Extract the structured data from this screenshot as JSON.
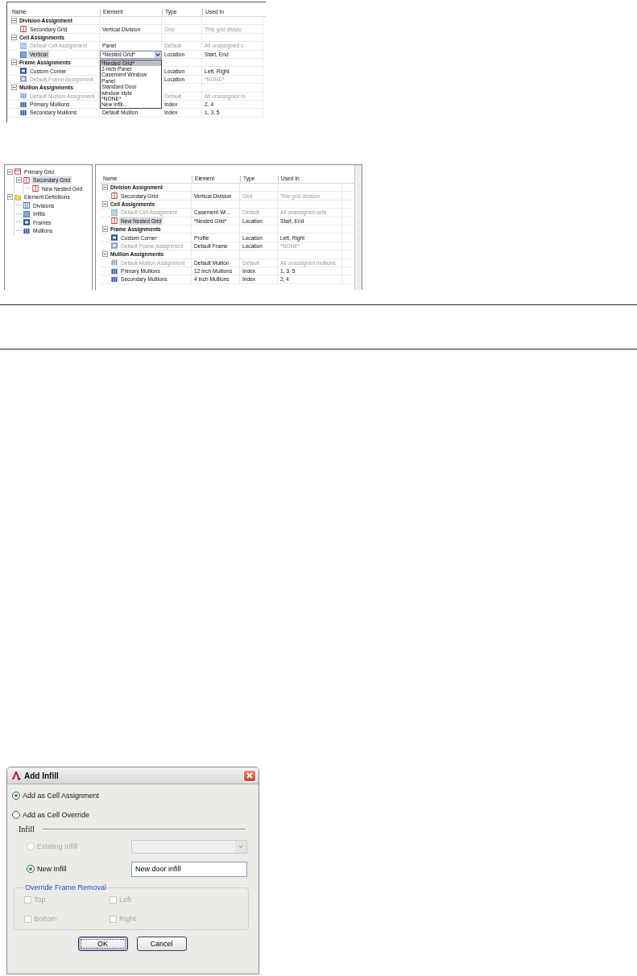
{
  "figure_1": {
    "columns": [
      "Name",
      "Element",
      "Type",
      "Used In"
    ],
    "groups": [
      {
        "title": "Division Assignment",
        "expanded": true,
        "rows": [
          {
            "kind": "division",
            "name": "Secondary Grid",
            "dimmed": false,
            "selected": false,
            "element": "Vertical Division",
            "type": "Grid",
            "type_dimmed": true,
            "used_in": "This grid divisio",
            "used_dimmed": true
          }
        ]
      },
      {
        "title": "Cell Assignments",
        "expanded": true,
        "rows": [
          {
            "kind": "infill",
            "name": "Default Cell Assignment",
            "dimmed": true,
            "selected": false,
            "element": "Panel",
            "type": "Default",
            "type_dimmed": true,
            "used_in": "All unassigned c",
            "used_dimmed": true
          },
          {
            "kind": "infill",
            "name": "Vertical",
            "dimmed": false,
            "selected": true,
            "combo": {
              "value": "*Nested Grid*",
              "options": [
                {
                  "label": "*Nested Grid*",
                  "selected": true
                },
                {
                  "label": "2-inch Panel",
                  "selected": false
                },
                {
                  "label": "Casement Window",
                  "selected": false
                },
                {
                  "label": "Panel",
                  "selected": false
                },
                {
                  "label": "Standard Door",
                  "selected": false
                },
                {
                  "label": "window style",
                  "selected": false
                },
                {
                  "label": "*NONE*",
                  "selected": false
                },
                {
                  "label": "New infill...",
                  "selected": false
                }
              ]
            },
            "type": "Location",
            "type_dimmed": false,
            "used_in": "Start, End",
            "used_dimmed": false
          }
        ]
      },
      {
        "title": "Frame Assignments",
        "expanded": true,
        "rows": [
          {
            "kind": "frame",
            "name": "Custom Corner",
            "dimmed": false,
            "selected": false,
            "type": "Location",
            "type_dimmed": false,
            "used_in": "Left, Right",
            "used_dimmed": false
          },
          {
            "kind": "frame",
            "name": "Default Frame Assignment",
            "dimmed": true,
            "selected": false,
            "type": "Location",
            "type_dimmed": false,
            "used_in": "*NONE*",
            "used_dimmed": true
          }
        ]
      },
      {
        "title": "Mullion Assignments",
        "expanded": true,
        "rows": [
          {
            "kind": "mullion",
            "name": "Default Mullion Assignment",
            "dimmed": true,
            "selected": false,
            "type": "Default",
            "type_dimmed": true,
            "used_in": "All unassigned m",
            "used_dimmed": true
          },
          {
            "kind": "mullion",
            "name": "Primary Mullions",
            "dimmed": false,
            "selected": false,
            "type": "Index",
            "type_dimmed": false,
            "used_in": "2, 4",
            "used_dimmed": false
          },
          {
            "kind": "mullion",
            "name": "Secondary Mullions",
            "dimmed": false,
            "selected": false,
            "element": "Default Mullion",
            "type": "Index",
            "type_dimmed": false,
            "used_in": "1, 3, 5",
            "used_dimmed": false
          }
        ]
      }
    ]
  },
  "figure_2": {
    "tree": [
      {
        "kind": "grid",
        "label": "Primary Grid",
        "selected": false,
        "expanded": true,
        "children": [
          {
            "kind": "division",
            "label": "Secondary Grid",
            "selected": true,
            "expanded": true,
            "children": [
              {
                "kind": "division",
                "label": "New Nested Grid",
                "selected": false
              }
            ]
          }
        ]
      },
      {
        "kind": "folder",
        "label": "Element Definitions",
        "selected": false,
        "expanded": true,
        "children": [
          {
            "kind": "divisions",
            "label": "Divisions",
            "selected": false
          },
          {
            "kind": "infill",
            "label": "Infills",
            "selected": false
          },
          {
            "kind": "frame",
            "label": "Frames",
            "selected": false
          },
          {
            "kind": "mullion",
            "label": "Mullions",
            "selected": false
          }
        ]
      }
    ],
    "columns": [
      "Name",
      "Element",
      "Type",
      "Used In"
    ],
    "groups": [
      {
        "title": "Division Assignment",
        "expanded": true,
        "rows": [
          {
            "kind": "division",
            "name": "Secondary Grid",
            "dimmed": false,
            "selected": false,
            "element": "Vertical Division",
            "type": "Grid",
            "type_dimmed": true,
            "used_in": "This grid division",
            "used_dimmed": true
          }
        ]
      },
      {
        "title": "Cell Assignments",
        "expanded": true,
        "rows": [
          {
            "kind": "infill",
            "name": "Default Cell Assignment",
            "dimmed": true,
            "selected": false,
            "element": "Casement Wi...",
            "type": "Default",
            "type_dimmed": true,
            "used_in": "All unassigned cells",
            "used_dimmed": true
          },
          {
            "kind": "division",
            "name": "New Nested Grid",
            "dimmed": false,
            "selected": true,
            "element": "*Nested Grid*",
            "type": "Location",
            "type_dimmed": false,
            "used_in": "Start, End",
            "used_dimmed": false
          }
        ]
      },
      {
        "title": "Frame Assignments",
        "expanded": true,
        "rows": [
          {
            "kind": "frame",
            "name": "Custom Corner",
            "dimmed": false,
            "selected": false,
            "element": "Profile",
            "type": "Location",
            "type_dimmed": false,
            "used_in": "Left, Right",
            "used_dimmed": false
          },
          {
            "kind": "frame",
            "name": "Default Frame Assignment",
            "dimmed": true,
            "selected": false,
            "element": "Default Frame",
            "type": "Location",
            "type_dimmed": false,
            "used_in": "*NONE*",
            "used_dimmed": true
          }
        ]
      },
      {
        "title": "Mullion Assignments",
        "expanded": true,
        "rows": [
          {
            "kind": "mullion",
            "name": "Default Mullion Assignment",
            "dimmed": true,
            "selected": false,
            "element": "Default Mullion",
            "type": "Default",
            "type_dimmed": true,
            "used_in": "All unassigned mullions",
            "used_dimmed": true
          },
          {
            "kind": "mullion",
            "name": "Primary Mullions",
            "dimmed": false,
            "selected": false,
            "element": "12 inch Mullions",
            "type": "Index",
            "type_dimmed": false,
            "used_in": "1, 3, 5",
            "used_dimmed": false
          },
          {
            "kind": "mullion",
            "name": "Secondary Mullions",
            "dimmed": false,
            "selected": false,
            "element": "4 inch Mullions",
            "type": "Index",
            "type_dimmed": false,
            "used_in": "2, 4",
            "used_dimmed": false
          }
        ]
      }
    ]
  },
  "dialog": {
    "title": "Add Infill",
    "assignment_options": [
      {
        "label": "Add as Cell Assignment",
        "selected": true
      },
      {
        "label": "Add as Cell Override",
        "selected": false
      }
    ],
    "infill_label": "Infill",
    "infill_options": [
      {
        "kind": "combo",
        "label": "Existing Infill",
        "selected": false,
        "disabled": true
      },
      {
        "kind": "text",
        "label": "New Infill",
        "selected": true,
        "disabled": false,
        "value": "New door infill"
      }
    ],
    "frame_group": "Override Frame Removal",
    "checkboxes": [
      {
        "label": "Top",
        "checked": false,
        "disabled": true
      },
      {
        "label": "Left",
        "checked": false,
        "disabled": true
      },
      {
        "label": "Bottom",
        "checked": false,
        "disabled": true
      },
      {
        "label": "Right",
        "checked": false,
        "disabled": true
      }
    ],
    "buttons": [
      {
        "label": "OK",
        "default": true
      },
      {
        "label": "Cancel",
        "default": false
      }
    ]
  }
}
